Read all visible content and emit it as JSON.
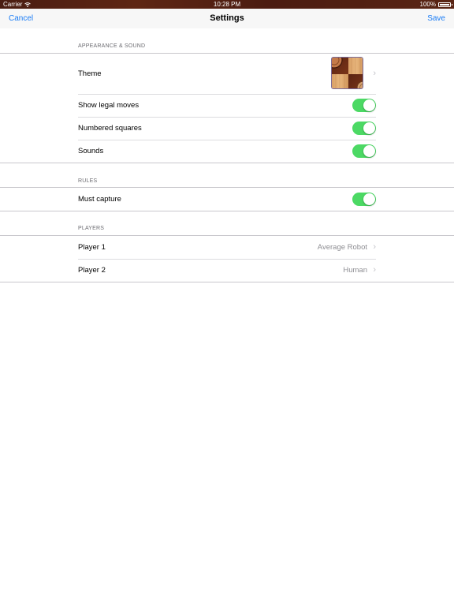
{
  "status_bar": {
    "carrier": "Carrier",
    "time": "10:28 PM",
    "battery": "100%"
  },
  "nav": {
    "cancel": "Cancel",
    "title": "Settings",
    "save": "Save"
  },
  "sections": {
    "appearance": {
      "header": "APPEARANCE & SOUND",
      "theme_label": "Theme",
      "show_legal_moves": {
        "label": "Show legal moves",
        "on": true
      },
      "numbered_squares": {
        "label": "Numbered squares",
        "on": true
      },
      "sounds": {
        "label": "Sounds",
        "on": true
      }
    },
    "rules": {
      "header": "RULES",
      "must_capture": {
        "label": "Must capture",
        "on": true
      }
    },
    "players": {
      "header": "PLAYERS",
      "player1": {
        "label": "Player 1",
        "value": "Average Robot"
      },
      "player2": {
        "label": "Player 2",
        "value": "Human"
      }
    }
  },
  "colors": {
    "accent": "#1a7cf6",
    "toggle_on": "#4cd964"
  }
}
